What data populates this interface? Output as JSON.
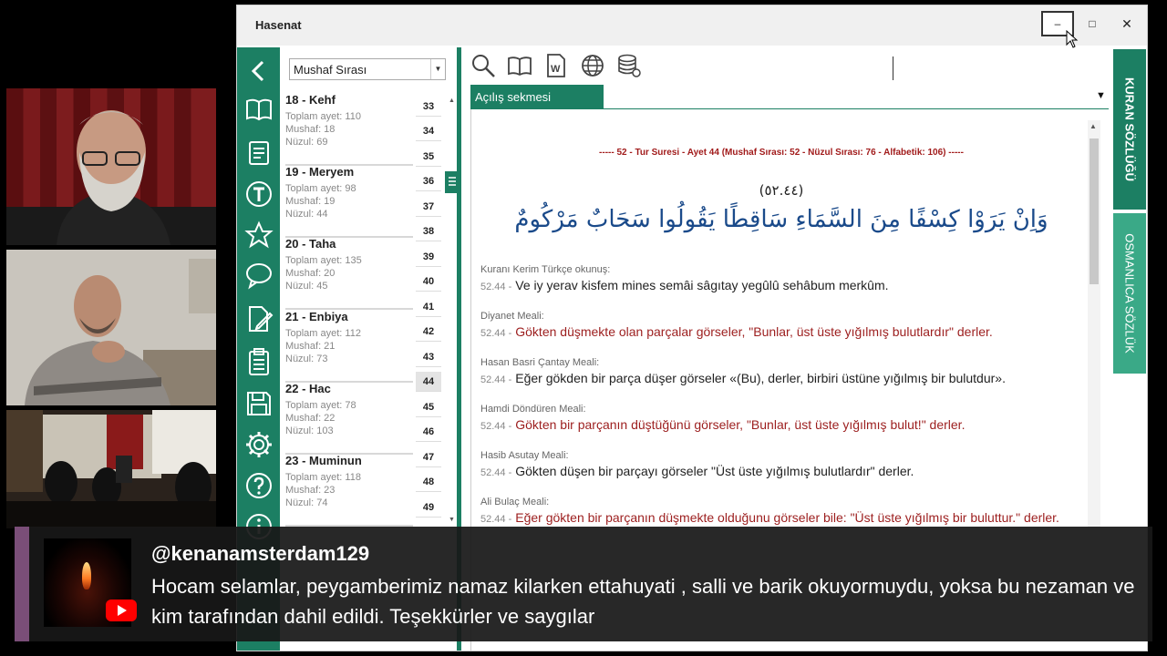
{
  "window": {
    "title": "Hasenat",
    "minimize": "–",
    "maximize": "□",
    "close": "✕"
  },
  "sidebar": {
    "icons": [
      "back-icon",
      "book-icon",
      "note-icon",
      "text-t-icon",
      "star-icon",
      "chat-bubble-icon",
      "edit-page-icon",
      "clipboard-icon",
      "save-icon",
      "gear-icon",
      "help-icon",
      "info-icon"
    ]
  },
  "surah_list": {
    "sort_select": "Mushaf Sırası",
    "items": [
      {
        "name": "18 - Kehf",
        "toplam": "Toplam ayet: 110",
        "mushaf": "Mushaf: 18",
        "nuzul": "Nüzul: 69"
      },
      {
        "name": "19 - Meryem",
        "toplam": "Toplam ayet: 98",
        "mushaf": "Mushaf: 19",
        "nuzul": "Nüzul: 44"
      },
      {
        "name": "20 - Taha",
        "toplam": "Toplam ayet: 135",
        "mushaf": "Mushaf: 20",
        "nuzul": "Nüzul: 45"
      },
      {
        "name": "21 - Enbiya",
        "toplam": "Toplam ayet: 112",
        "mushaf": "Mushaf: 21",
        "nuzul": "Nüzul: 73"
      },
      {
        "name": "22 - Hac",
        "toplam": "Toplam ayet: 78",
        "mushaf": "Mushaf: 22",
        "nuzul": "Nüzul: 103"
      },
      {
        "name": "23 - Muminun",
        "toplam": "Toplam ayet: 118",
        "mushaf": "Mushaf: 23",
        "nuzul": "Nüzul: 74"
      }
    ]
  },
  "ayah_numbers": [
    "33",
    "34",
    "35",
    "36",
    "37",
    "38",
    "39",
    "40",
    "41",
    "42",
    "43",
    "44",
    "45",
    "46",
    "47",
    "48",
    "49"
  ],
  "active_ayah": "44",
  "toolbar": {
    "icons": [
      "search-icon",
      "open-book-icon",
      "word-doc-icon",
      "globe-icon",
      "database-refresh-icon"
    ]
  },
  "tab": {
    "label": "Açılış sekmesi"
  },
  "content": {
    "header": "-----   52 - Tur Suresi - Ayet 44 (Mushaf Sırası: 52 - Nüzul Sırası: 76 - Alfabetik: 106)   -----",
    "arabic_number": "(٥٢.٤٤)",
    "arabic_verse": "وَاِنْ يَرَوْا كِسْفًا مِنَ السَّمَاءِ سَاقِطًا يَقُولُوا سَحَابٌ مَرْكُومٌ",
    "meals": [
      {
        "label": "Kuranı Kerim Türkçe okunuş:",
        "ref": "52.44 -",
        "text": "Ve iy yerav kisfem mines semâi sâgıtay yegûlû sehâbum merkûm.",
        "style": "black"
      },
      {
        "label": "Diyanet Meali:",
        "ref": "52.44 -",
        "text": "Gökten düşmekte olan parçalar görseler, \"Bunlar, üst üste yığılmış bulutlardır\" derler.",
        "style": "red"
      },
      {
        "label": "Hasan Basri Çantay Meali:",
        "ref": "52.44 -",
        "text": "Eğer gökden bir parça düşer görseler «(Bu), derler, birbiri üstüne yığılmış bir bulutdur».",
        "style": "black"
      },
      {
        "label": "Hamdi Döndüren Meali:",
        "ref": "52.44 -",
        "text": "Gökten bir parçanın düştüğünü görseler, \"Bunlar, üst üste yığılmış bulut!\" derler.",
        "style": "red"
      },
      {
        "label": "Hasib Asutay Meali:",
        "ref": "52.44 -",
        "text": "Gökten düşen bir parçayı görseler \"Üst üste yığılmış bulutlardır\" derler.",
        "style": "black"
      },
      {
        "label": "Ali Bulaç Meali:",
        "ref": "52.44 -",
        "text": "Eğer gökten bir parçanın düşmekte olduğunu görseler bile: \"Üst üste yığılmış bir buluttur.\" derler.",
        "style": "red"
      }
    ]
  },
  "right_tabs": {
    "kuran_sozlugu": "KURAN SÖZLÜĞÜ",
    "osmanlica_sozluk": "OSMANLICA SÖZLÜK"
  },
  "chat": {
    "username": "@kenanamsterdam129",
    "message": "Hocam selamlar, peygamberimiz namaz kilarken ettahuyati , salli ve barik okuyormuydu, yoksa bu nezaman ve kim tarafından dahil edildi. Teşekkürler ve saygılar"
  },
  "colors": {
    "accent": "#1c7f63",
    "verse_blue": "#1a4a8a",
    "meal_red": "#9c1e1e"
  }
}
